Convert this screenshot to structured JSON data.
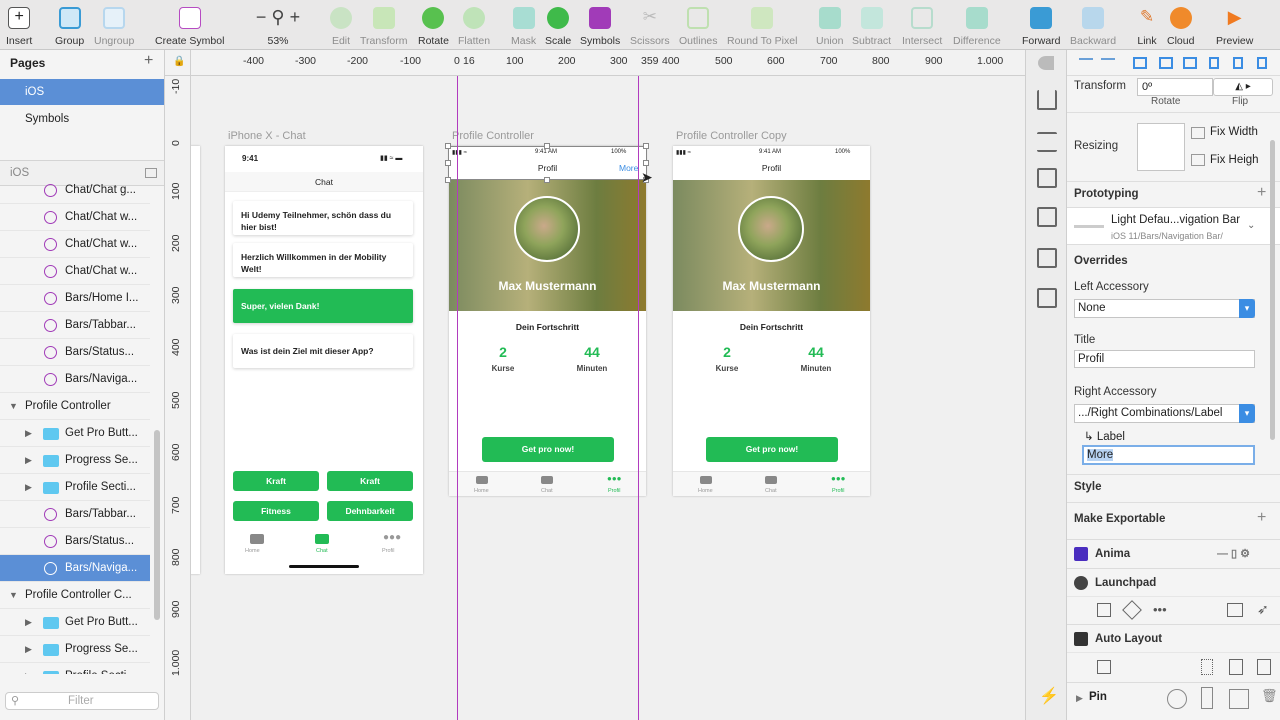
{
  "toolbar": {
    "insert": "Insert",
    "group": "Group",
    "ungroup": "Ungroup",
    "create_symbol": "Create Symbol",
    "zoom": "53%",
    "edit": "Edit",
    "transform": "Transform",
    "rotate": "Rotate",
    "flatten": "Flatten",
    "mask": "Mask",
    "scale": "Scale",
    "symbols": "Symbols",
    "scissors": "Scissors",
    "outlines": "Outlines",
    "round_to_pixel": "Round To Pixel",
    "union": "Union",
    "subtract": "Subtract",
    "intersect": "Intersect",
    "difference": "Difference",
    "forward": "Forward",
    "backward": "Backward",
    "link": "Link",
    "cloud": "Cloud",
    "preview": "Preview"
  },
  "pages": {
    "title": "Pages",
    "items": [
      "iOS",
      "Symbols"
    ],
    "current": "iOS"
  },
  "layers": [
    {
      "kind": "sym",
      "label": "Chat/Chat g..."
    },
    {
      "kind": "sym",
      "label": "Chat/Chat w..."
    },
    {
      "kind": "sym",
      "label": "Chat/Chat w..."
    },
    {
      "kind": "sym",
      "label": "Chat/Chat w..."
    },
    {
      "kind": "sym",
      "label": "Bars/Home I..."
    },
    {
      "kind": "sym",
      "label": "Bars/Tabbar..."
    },
    {
      "kind": "sym",
      "label": "Bars/Status..."
    },
    {
      "kind": "sym",
      "label": "Bars/Naviga..."
    },
    {
      "kind": "art",
      "label": "Profile Controller"
    },
    {
      "kind": "fold",
      "label": "Get Pro Butt..."
    },
    {
      "kind": "fold",
      "label": "Progress Se..."
    },
    {
      "kind": "fold",
      "label": "Profile Secti..."
    },
    {
      "kind": "sym",
      "label": "Bars/Tabbar..."
    },
    {
      "kind": "sym",
      "label": "Bars/Status..."
    },
    {
      "kind": "sym",
      "label": "Bars/Naviga..."
    },
    {
      "kind": "art",
      "label": "Profile Controller C..."
    },
    {
      "kind": "fold",
      "label": "Get Pro Butt..."
    },
    {
      "kind": "fold",
      "label": "Progress Se..."
    },
    {
      "kind": "fold",
      "label": "Profile Secti..."
    }
  ],
  "filter_placeholder": "Filter",
  "ruler": {
    "h": [
      "-400",
      "-300",
      "-200",
      "-100",
      "0",
      "16",
      "100",
      "200",
      "300",
      "359",
      "400",
      "500",
      "600",
      "700",
      "800",
      "900",
      "1.000"
    ],
    "v": [
      "-10",
      "0",
      "100",
      "200",
      "300",
      "400",
      "500",
      "600",
      "700",
      "800",
      "900",
      "1.000"
    ]
  },
  "artboards": {
    "chat": {
      "title": "iPhone X - Chat",
      "time": "9:41",
      "nav_title": "Chat",
      "messages": [
        "Hi Udemy Teilnehmer, schön dass du hier bist!",
        "Herzlich Willkommen in der Mobility Welt!",
        "Super, vielen Dank!",
        "Was ist dein Ziel mit dieser App?"
      ],
      "chips": [
        "Kraft",
        "Kraft",
        "Fitness",
        "Dehnbarkeit"
      ],
      "tabs": [
        "Home",
        "Chat",
        "Profil"
      ]
    },
    "profile": {
      "title": "Profile Controller",
      "time": "9:41 AM",
      "battery": "100%",
      "nav_title": "Profil",
      "nav_right": "More",
      "name": "Max Mustermann",
      "progress_title": "Dein Fortschritt",
      "stat1_value": "2",
      "stat1_label": "Kurse",
      "stat2_value": "44",
      "stat2_label": "Minuten",
      "cta": "Get pro now!",
      "tabs": [
        "Home",
        "Chat",
        "Profil"
      ]
    },
    "profile_copy": {
      "title": "Profile Controller Copy",
      "time": "9:41 AM",
      "battery": "100%",
      "nav_title": "Profil",
      "name": "Max Mustermann",
      "progress_title": "Dein Fortschritt",
      "stat1_value": "2",
      "stat1_label": "Kurse",
      "stat2_value": "44",
      "stat2_label": "Minuten",
      "cta": "Get pro now!",
      "tabs": [
        "Home",
        "Chat",
        "Profil"
      ]
    }
  },
  "inspector": {
    "transform_label": "Transform",
    "rotate_value": "0º",
    "rotate_label": "Rotate",
    "flip_label": "Flip",
    "resizing_label": "Resizing",
    "fix_width": "Fix Width",
    "fix_height": "Fix Heigh",
    "prototyping": "Prototyping",
    "symbol_name": "Light Defau...vigation Bar",
    "symbol_path": "iOS 11/Bars/Navigation Bar/",
    "overrides": "Overrides",
    "left_accessory_label": "Left Accessory",
    "left_accessory_value": "None",
    "title_label": "Title",
    "title_value": "Profil",
    "right_accessory_label": "Right Accessory",
    "right_accessory_value": ".../Right Combinations/Label",
    "sub_label": "↳ Label",
    "sub_label_value": "More",
    "style": "Style",
    "make_exportable": "Make Exportable",
    "plugins": [
      "Anima",
      "Launchpad",
      "Auto Layout"
    ],
    "pin": "Pin"
  },
  "colors": {
    "accent": "#3b8de3",
    "selection": "#5b8fd6",
    "green": "#22bb55",
    "guide": "#b13bbf"
  }
}
